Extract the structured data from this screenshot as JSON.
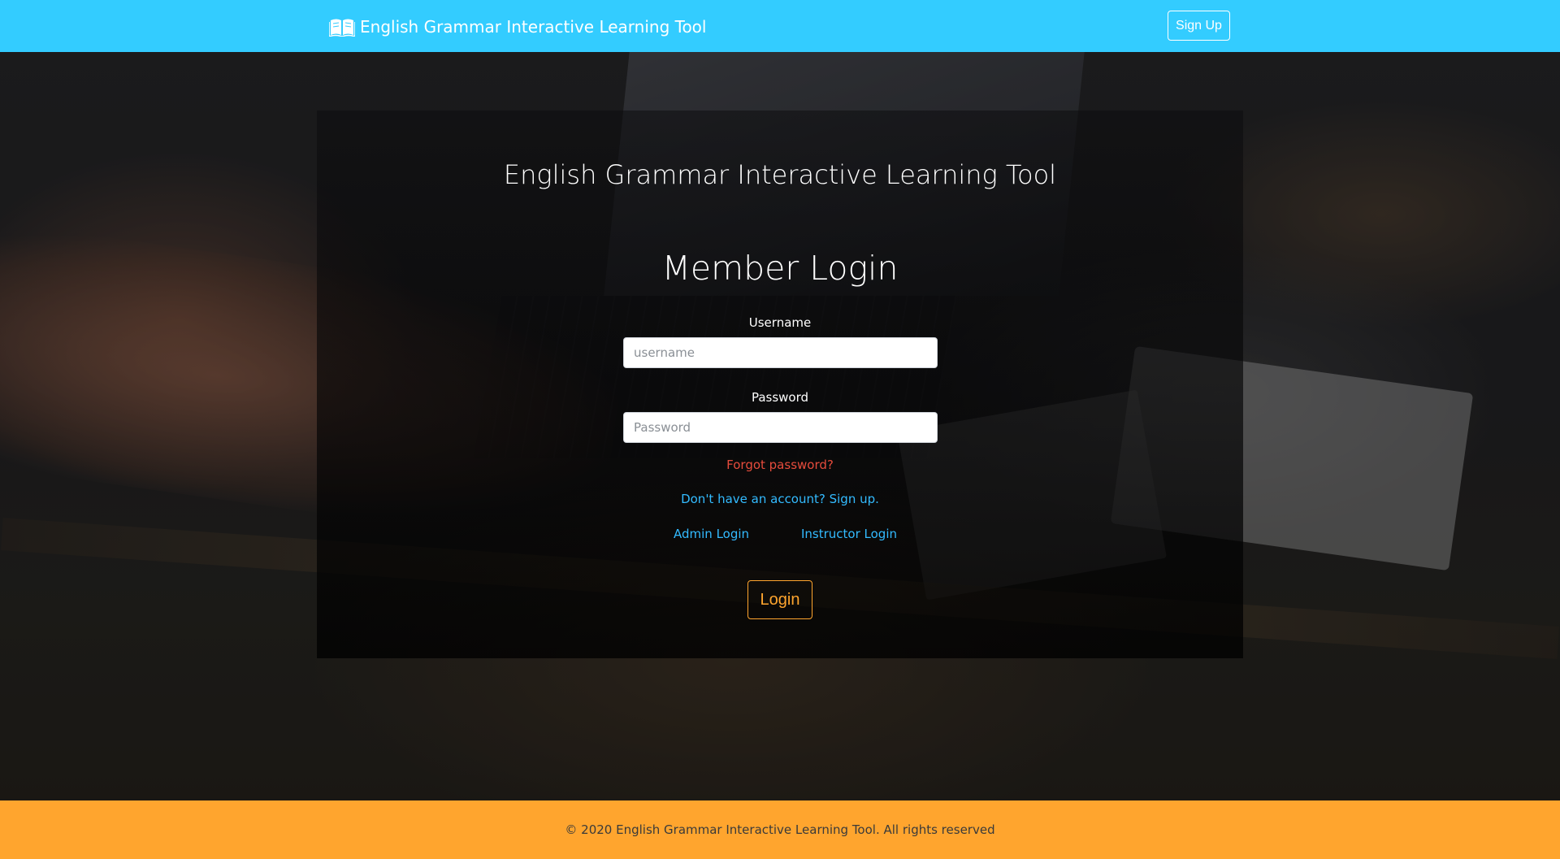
{
  "navbar": {
    "brand_text": "English Grammar Interactive Learning Tool",
    "brand_icon": "open-book-icon",
    "signup_label": "Sign Up",
    "background_color": "#33ccff"
  },
  "login": {
    "app_title": "English Grammar Interactive Learning Tool",
    "heading": "Member Login",
    "username_label": "Username",
    "username_placeholder": "username",
    "username_value": "",
    "password_label": "Password",
    "password_placeholder": "Password",
    "password_value": "",
    "forgot_password": "Forgot password?",
    "signup_prompt": "Don't have an account? Sign up.",
    "admin_login": "Admin Login",
    "instructor_login": "Instructor Login",
    "login_button": "Login"
  },
  "footer": {
    "text": "© 2020 English Grammar Interactive Learning Tool. All rights reserved",
    "background_color": "#ffa52e"
  },
  "colors": {
    "link_blue": "#33bbff",
    "forgot_red": "#e74c3c",
    "login_orange": "#ffa52e"
  }
}
